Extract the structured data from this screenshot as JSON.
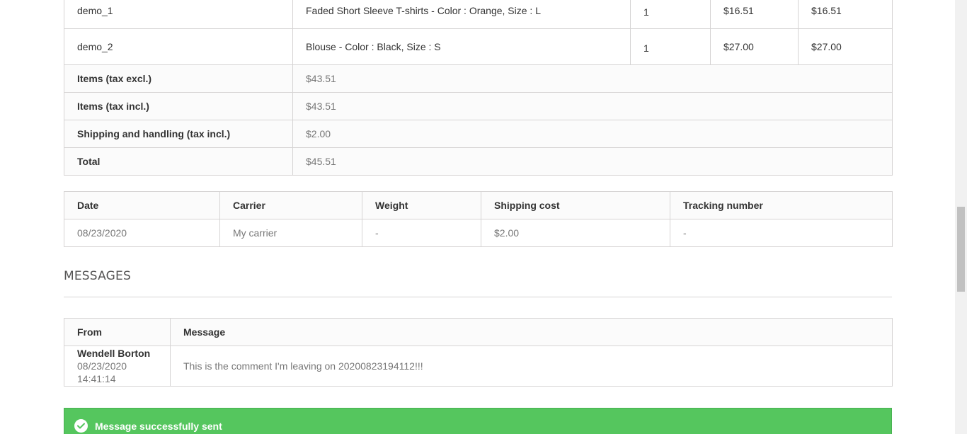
{
  "products": {
    "rows": [
      {
        "reference": "demo_1",
        "product": "Faded Short Sleeve T-shirts - Color : Orange, Size : L",
        "quantity": "1",
        "unit_price": "$16.51",
        "total_price": "$16.51"
      },
      {
        "reference": "demo_2",
        "product": "Blouse - Color : Black, Size : S",
        "quantity": "1",
        "unit_price": "$27.00",
        "total_price": "$27.00"
      }
    ],
    "totals": [
      {
        "label": "Items (tax excl.)",
        "value": "$43.51"
      },
      {
        "label": "Items (tax incl.)",
        "value": "$43.51"
      },
      {
        "label": "Shipping and handling (tax incl.)",
        "value": "$2.00"
      },
      {
        "label": "Total",
        "value": "$45.51"
      }
    ]
  },
  "shipping": {
    "headers": [
      "Date",
      "Carrier",
      "Weight",
      "Shipping cost",
      "Tracking number"
    ],
    "row": [
      "08/23/2020",
      "My carrier",
      "-",
      "$2.00",
      "-"
    ]
  },
  "messages": {
    "title": "MESSAGES",
    "headers": [
      "From",
      "Message"
    ],
    "items": [
      {
        "author": "Wendell Borton",
        "date": "08/23/2020 14:41:14",
        "text": "This is the comment I'm leaving on 20200823194112!!!"
      }
    ]
  },
  "alert": {
    "text": "Message successfully sent",
    "icon": "check-circle-icon",
    "color": "#55c65e"
  }
}
